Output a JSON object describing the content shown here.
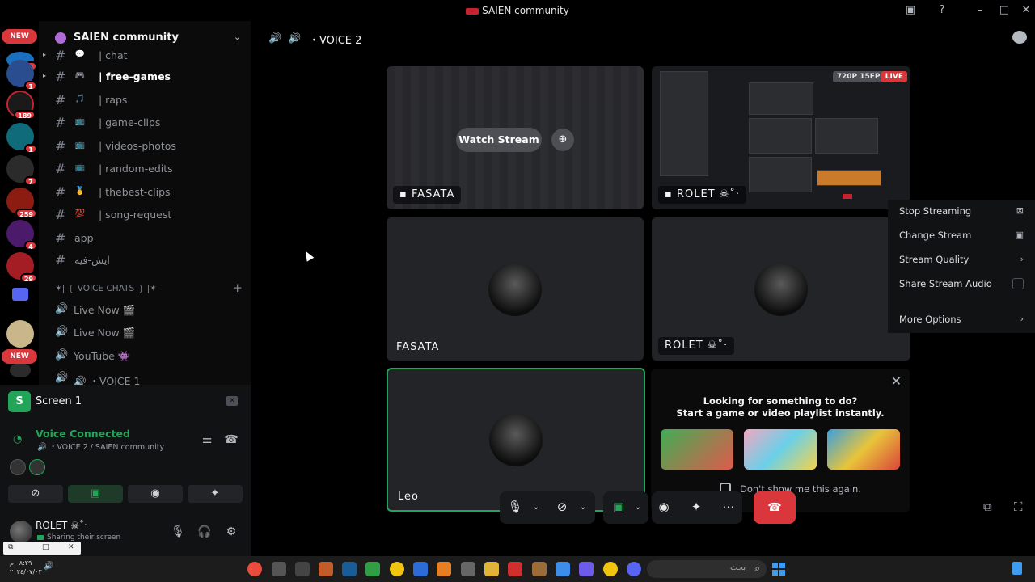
{
  "window": {
    "title": "SAIEN community"
  },
  "rail": {
    "new_label": "NEW",
    "badges": [
      "8",
      "1",
      "189",
      "1",
      "7",
      "259",
      "4",
      "29"
    ],
    "new_label_2": "NEW"
  },
  "guild": {
    "name": "SAIEN community"
  },
  "channels": [
    {
      "label": "| chat",
      "emoji": "💬"
    },
    {
      "label": "| free-games",
      "emoji": "🎮"
    },
    {
      "label": "| raps",
      "emoji": "🎵"
    },
    {
      "label": "| game-clips",
      "emoji": "📺"
    },
    {
      "label": "| videos-photos",
      "emoji": "📺"
    },
    {
      "label": "| random-edits",
      "emoji": "📺"
    },
    {
      "label": "| thebest-clips",
      "emoji": "🥇"
    },
    {
      "label": "| song-request",
      "emoji": "💯"
    },
    {
      "label": "app",
      "emoji": ""
    },
    {
      "label": "ايش-فيه",
      "emoji": ""
    }
  ],
  "voice_category": "✶| ❲ VOICE CHATS ❳ |✶",
  "voice_channels": [
    {
      "label": "Live Now 🎬"
    },
    {
      "label": "Live Now 🎬"
    },
    {
      "label": "YouTube 👾"
    },
    {
      "label": "🔊 ・VOICE 1"
    }
  ],
  "screen_share": {
    "icon_letter": "S",
    "label": "Screen 1"
  },
  "voice_connection": {
    "status": "Voice Connected",
    "location": "🔊 ・VOICE 2 / SAIEN community"
  },
  "user": {
    "name": "ROLET ☠︎˚‧",
    "status": "Sharing their screen"
  },
  "voice_header": {
    "title": "・VOICE 2"
  },
  "tiles": {
    "stream_1": {
      "name": "FASATA",
      "watch": "Watch Stream"
    },
    "stream_2": {
      "name": "ROLET ☠︎˚‧",
      "resolution": "720P 15FPS",
      "live": "LIVE"
    },
    "cam_1": {
      "name": "FASATA"
    },
    "cam_2": {
      "name": "ROLET ☠︎˚‧"
    },
    "cam_3": {
      "name": "Leo"
    }
  },
  "activity": {
    "line1": "Looking for something to do?",
    "line2": "Start a game or video playlist instantly.",
    "dont_show": "Don't show me this again."
  },
  "stream_menu": {
    "items": [
      "Stop Streaming",
      "Change Stream",
      "Stream Quality",
      "Share Stream Audio",
      "More Options"
    ]
  },
  "taskbar": {
    "clock": "٠٨:٢٩ م",
    "date": "٢٠٢٤/٠٧/٠٢",
    "search_text": "بحث"
  },
  "colors": {
    "accent_green": "#23a559",
    "danger_red": "#da373c",
    "background": "#000000"
  }
}
